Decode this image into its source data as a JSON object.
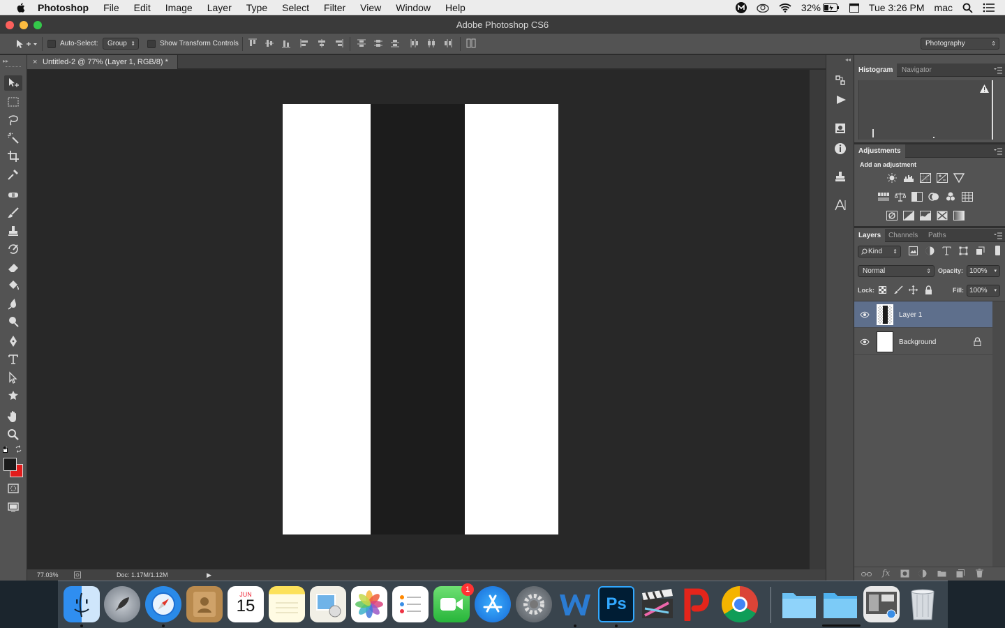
{
  "menubar": {
    "app_name": "Photoshop",
    "items": [
      "File",
      "Edit",
      "Image",
      "Layer",
      "Type",
      "Select",
      "Filter",
      "View",
      "Window",
      "Help"
    ],
    "battery": "32%",
    "clock": "Tue 3:26 PM",
    "user": "mac"
  },
  "window": {
    "title": "Adobe Photoshop CS6"
  },
  "options_bar": {
    "auto_select_label": "Auto-Select:",
    "auto_select_value": "Group",
    "show_transform_label": "Show Transform Controls",
    "workspace_value": "Photography"
  },
  "document": {
    "tab_title": "Untitled-2 @ 77% (Layer 1, RGB/8) *",
    "close_glyph": "×",
    "zoom": "77.03%",
    "doc_size": "Doc: 1.17M/1.12M"
  },
  "colors": {
    "foreground": "#1a1a1a",
    "background": "#e21b1b",
    "canvas_stripe": "#1c1c1c",
    "selection_highlight": "#5e6f8c"
  },
  "panels": {
    "top_tabs": [
      "Histogram",
      "Navigator"
    ],
    "adjustments_tab": "Adjustments",
    "adjustments_heading": "Add an adjustment",
    "layers_tabs": [
      "Layers",
      "Channels",
      "Paths"
    ],
    "filter_kind": "Kind",
    "blend_mode": "Normal",
    "opacity_label": "Opacity:",
    "opacity_value": "100%",
    "lock_label": "Lock:",
    "fill_label": "Fill:",
    "fill_value": "100%",
    "layers": [
      {
        "name": "Layer 1",
        "selected": true
      },
      {
        "name": "Background",
        "selected": false
      }
    ]
  },
  "dock": {
    "calendar_month": "JUN",
    "calendar_day": "15",
    "facetime_badge": "1",
    "photoshop_label": "Ps"
  }
}
